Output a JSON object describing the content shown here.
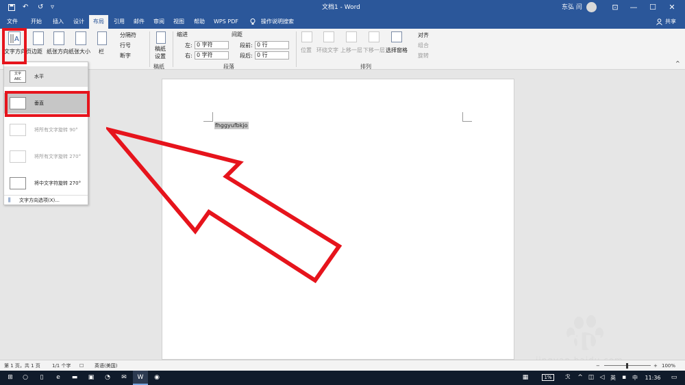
{
  "title_bar": {
    "doc_title": "文档1 - Word",
    "user_name": "东弘 闫",
    "undo": "↶",
    "redo": "↺",
    "customize": "▿"
  },
  "window_controls": {
    "ribbon_display": "⊡",
    "minimize": "—",
    "maximize": "☐",
    "close": "✕"
  },
  "tabs": [
    "文件",
    "开始",
    "插入",
    "设计",
    "布局",
    "引用",
    "邮件",
    "审阅",
    "视图",
    "帮助",
    "WPS PDF"
  ],
  "active_tab": "布局",
  "tell_me": "操作说明搜索",
  "share": "共享",
  "ribbon": {
    "text_direction": "文字方向",
    "margins": "页边距",
    "orientation": "纸张方向",
    "size": "纸张大小",
    "columns": "栏",
    "breaks": "分隔符",
    "line_numbers": "行号",
    "hyphenation": "断字",
    "draft_paper_line1": "稿纸",
    "draft_paper_line2": "设置",
    "draft_group": "稿纸",
    "indent_header": "缩进",
    "spacing_header": "间距",
    "indent_left_label": "左:",
    "indent_left_value": "0 字符",
    "indent_right_label": "右:",
    "indent_right_value": "0 字符",
    "spacing_before_label": "段前:",
    "spacing_before_value": "0 行",
    "spacing_after_label": "段后:",
    "spacing_after_value": "0 行",
    "paragraph_group": "段落",
    "position": "位置",
    "wrap_text": "环绕文字",
    "bring_forward": "上移一层",
    "send_backward": "下移一层",
    "selection_pane": "选择窗格",
    "align": "对齐",
    "group": "组合",
    "rotate": "旋转",
    "arrange_group": "排列"
  },
  "dropdown": {
    "items": [
      {
        "label": "水平",
        "icon": "文字\nABC",
        "enabled": true
      },
      {
        "label": "垂直",
        "icon": "",
        "enabled": true
      },
      {
        "label": "将所有文字旋转 90°",
        "icon": "",
        "enabled": false
      },
      {
        "label": "将所有文字旋转 270°",
        "icon": "",
        "enabled": false
      },
      {
        "label": "将中文字符旋转 270°",
        "icon": "",
        "enabled": true
      }
    ],
    "options_label": "文字方向选项(X)..."
  },
  "document": {
    "selected_text": "fhggyufbkjo"
  },
  "status_bar": {
    "page": "第 1 页，共 1 页",
    "words": "1/1 个字",
    "language": "英语(美国)",
    "zoom_minus": "−",
    "zoom_plus": "+",
    "zoom": "100%"
  },
  "taskbar": {
    "battery": "1%",
    "ime": "中",
    "time": "11:36",
    "lang_icon": "英"
  },
  "watermark": {
    "brand": "Baidu",
    "cn": "经验",
    "url": "jingyan.baidu.com"
  },
  "colors": {
    "accent": "#2b579a",
    "highlight": "#e6141c"
  }
}
